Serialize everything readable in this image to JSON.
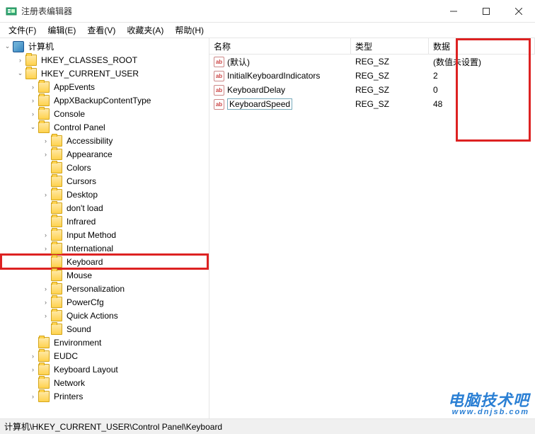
{
  "titlebar": {
    "title": "注册表编辑器"
  },
  "menu": {
    "file": "文件(F)",
    "edit": "编辑(E)",
    "view": "查看(V)",
    "favorites": "收藏夹(A)",
    "help": "帮助(H)"
  },
  "tree": {
    "root": "计算机",
    "hkeys": {
      "classes_root": "HKEY_CLASSES_ROOT",
      "current_user": "HKEY_CURRENT_USER"
    },
    "hkcu": {
      "appevents": "AppEvents",
      "appxbackup": "AppXBackupContentType",
      "console": "Console",
      "control_panel": "Control Panel",
      "environment": "Environment",
      "eudc": "EUDC",
      "keyboard_layout": "Keyboard Layout",
      "network": "Network",
      "printers": "Printers"
    },
    "control_panel": {
      "accessibility": "Accessibility",
      "appearance": "Appearance",
      "colors": "Colors",
      "cursors": "Cursors",
      "desktop": "Desktop",
      "dont_load": "don't load",
      "infrared": "Infrared",
      "input_method": "Input Method",
      "international": "International",
      "keyboard": "Keyboard",
      "mouse": "Mouse",
      "personalization": "Personalization",
      "powercfg": "PowerCfg",
      "quick_actions": "Quick Actions",
      "sound": "Sound"
    }
  },
  "list": {
    "headers": {
      "name": "名称",
      "type": "类型",
      "data": "数据"
    },
    "rows": [
      {
        "name": "(默认)",
        "type": "REG_SZ",
        "data": "(数值未设置)",
        "selected": false
      },
      {
        "name": "InitialKeyboardIndicators",
        "type": "REG_SZ",
        "data": "2",
        "selected": false
      },
      {
        "name": "KeyboardDelay",
        "type": "REG_SZ",
        "data": "0",
        "selected": false
      },
      {
        "name": "KeyboardSpeed",
        "type": "REG_SZ",
        "data": "48",
        "selected": true
      }
    ]
  },
  "statusbar": {
    "path": "计算机\\HKEY_CURRENT_USER\\Control Panel\\Keyboard"
  },
  "watermark": {
    "main": "电脑技术吧",
    "sub": "www.dnjsb.com"
  }
}
